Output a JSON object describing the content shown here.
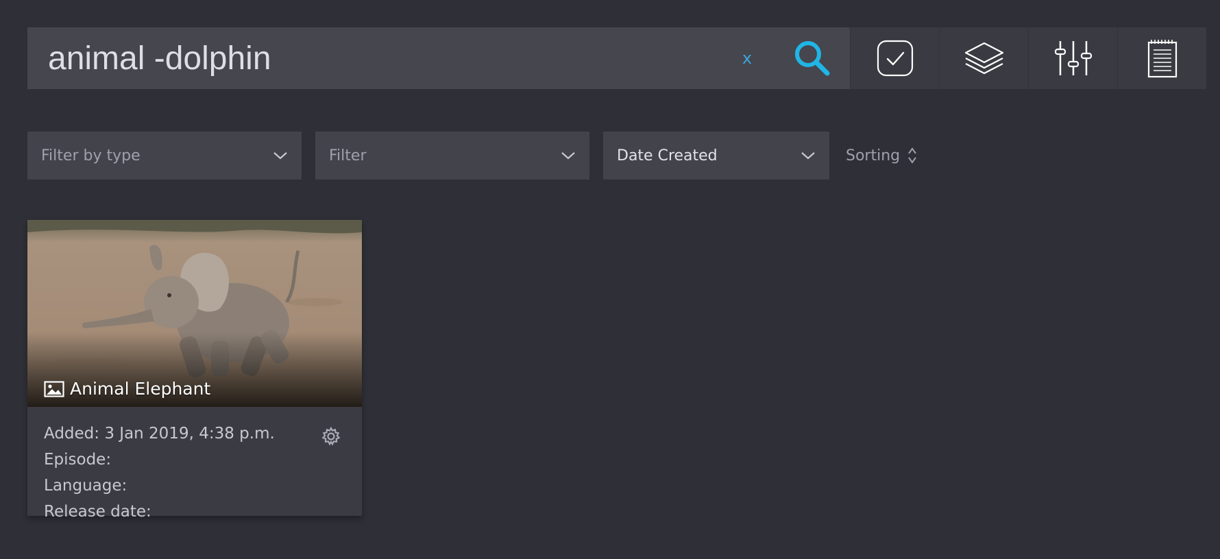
{
  "search": {
    "query": "animal -dolphin",
    "clear_label": "x",
    "icons": [
      "search-icon",
      "select-checkbox-icon",
      "layers-icon",
      "sliders-icon",
      "notepad-icon"
    ],
    "accent_color": "#1fb6e6"
  },
  "filters": {
    "type_placeholder": "Filter by type",
    "filter_placeholder": "Filter",
    "sort_field": "Date Created",
    "sorting_label": "Sorting"
  },
  "results": [
    {
      "title": "Animal Elephant",
      "media_icon": "image-icon",
      "added": "Added: 3 Jan 2019, 4:38 p.m.",
      "episode": "Episode:",
      "language": "Language:",
      "release_date": "Release date:"
    }
  ]
}
